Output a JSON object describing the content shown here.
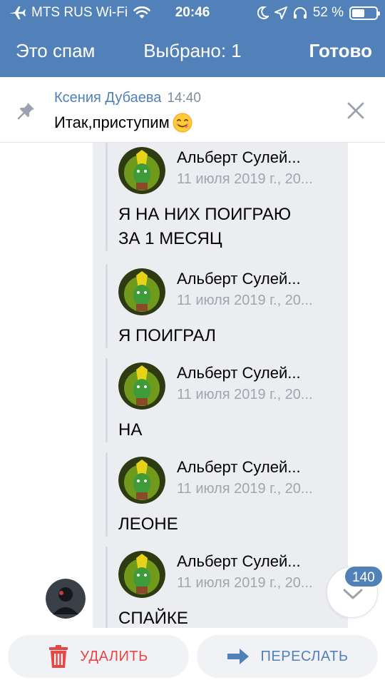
{
  "status_bar": {
    "carrier": "MTS RUS Wi-Fi",
    "time": "20:46",
    "battery": "52 %",
    "battery_level": 0.52
  },
  "nav": {
    "left_label": "Это спам",
    "title": "Выбрано: 1",
    "right_label": "Готово"
  },
  "pinned": {
    "author": "Ксения Дубаева",
    "time": "14:40",
    "text": "Итак,приступим"
  },
  "forwarded": [
    {
      "name": "Альберт Сулей...",
      "date": "11 июля 2019 г., 20...",
      "text_lines": [
        "Я НА НИХ ПОИГРАЮ",
        "ЗА 1 МЕСЯЦ"
      ]
    },
    {
      "name": "Альберт Сулей...",
      "date": "11 июля 2019 г., 20...",
      "text_lines": [
        "Я ПОИГРАЛ"
      ]
    },
    {
      "name": "Альберт Сулей...",
      "date": "11 июля 2019 г., 20...",
      "text_lines": [
        "НА"
      ]
    },
    {
      "name": "Альберт Сулей...",
      "date": "11 июля 2019 г., 20...",
      "text_lines": [
        "ЛЕОНЕ"
      ]
    },
    {
      "name": "Альберт Сулей...",
      "date": "11 июля 2019 г., 20...",
      "text_lines": [
        "СПАЙКЕ"
      ]
    }
  ],
  "scroll_badge": "140",
  "actions": {
    "delete_label": "УДАЛИТЬ",
    "forward_label": "ПЕРЕСЛАТЬ"
  },
  "colors": {
    "brand": "#5181b8",
    "danger": "#e64646",
    "selection": "#ebedf0"
  }
}
